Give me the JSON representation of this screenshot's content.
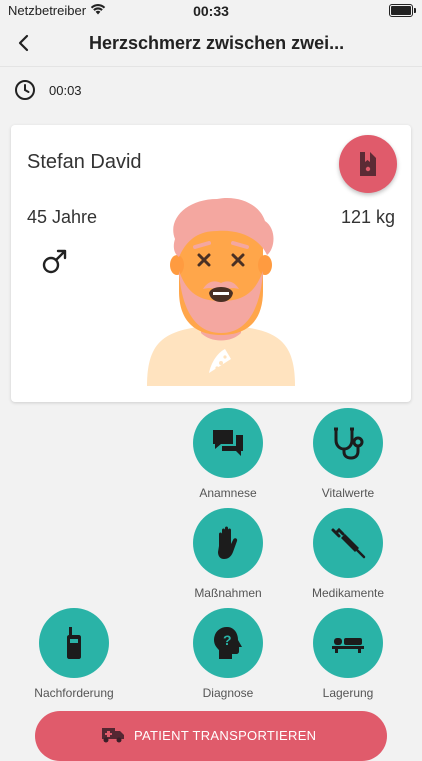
{
  "status": {
    "carrier": "Netzbetreiber",
    "time": "00:33"
  },
  "nav": {
    "title": "Herzschmerz zwischen zwei..."
  },
  "timer": {
    "value": "00:03"
  },
  "patient": {
    "name": "Stefan David",
    "age": "45 Jahre",
    "weight": "121 kg",
    "gender_symbol": "♂"
  },
  "actions": {
    "anamnese": "Anamnese",
    "vitalwerte": "Vitalwerte",
    "massnahmen": "Maßnahmen",
    "medikamente": "Medikamente",
    "nachforderung": "Nachforderung",
    "diagnose": "Diagnose",
    "lagerung": "Lagerung"
  },
  "transport": {
    "label": "PATIENT TRANSPORTIEREN"
  },
  "colors": {
    "accent_teal": "#2ab3a7",
    "accent_red": "#e05b6b"
  }
}
